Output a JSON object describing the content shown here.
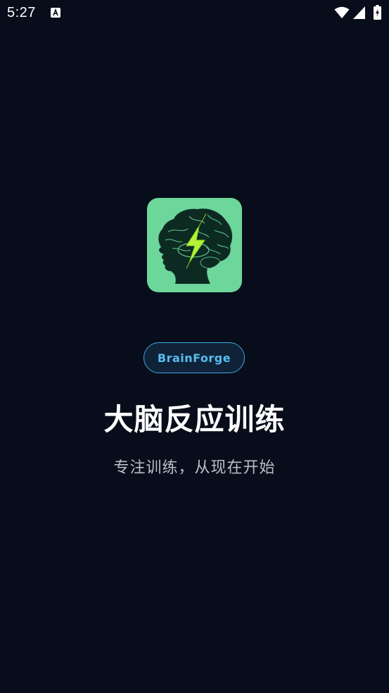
{
  "status_bar": {
    "time": "5:27",
    "notification_icon": "a-letter-icon",
    "wifi_icon": "wifi-icon",
    "signal_icon": "cell-signal-icon",
    "battery_icon": "battery-charging-icon"
  },
  "splash": {
    "logo_icon": "brain-lightning-icon",
    "brand_name": "BrainForge",
    "title": "大脑反应训练",
    "subtitle": "专注训练，从现在开始"
  },
  "colors": {
    "background": "#070d1a",
    "logo_background": "#6dd69b",
    "pill_border": "#3fa8e6",
    "pill_text": "#58bdf0",
    "subtitle_text": "#b8bfc9"
  }
}
